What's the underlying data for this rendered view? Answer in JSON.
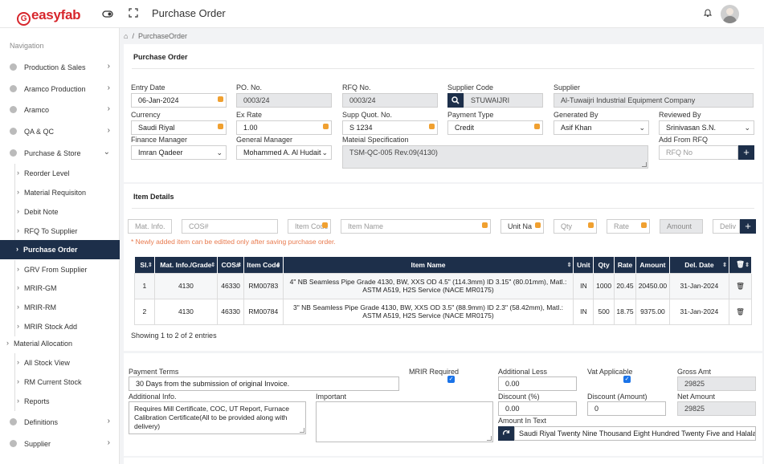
{
  "header": {
    "logo": "easyfab",
    "logo_mark": "G",
    "page_title": "Purchase Order"
  },
  "breadcrumb": {
    "current": "PurchaseOrder"
  },
  "sidebar": {
    "title": "Navigation",
    "items": [
      {
        "label": "Production & Sales"
      },
      {
        "label": "Aramco Production"
      },
      {
        "label": "Aramco"
      },
      {
        "label": "QA & QC"
      },
      {
        "label": "Purchase & Store"
      }
    ],
    "sub_items": [
      {
        "label": "Reorder Level"
      },
      {
        "label": "Material Requisiton"
      },
      {
        "label": "Debit Note"
      },
      {
        "label": "RFQ To Supplier"
      },
      {
        "label": "Purchase Order"
      },
      {
        "label": "GRV From Supplier"
      },
      {
        "label": "MRIR-GM"
      },
      {
        "label": "MRIR-RM"
      },
      {
        "label": "MRIR Stock Add"
      },
      {
        "label": "Material Allocation"
      },
      {
        "label": "All Stock View"
      },
      {
        "label": "RM Current Stock"
      },
      {
        "label": "Reports"
      }
    ],
    "bottom_items": [
      {
        "label": "Definitions"
      },
      {
        "label": "Supplier"
      }
    ]
  },
  "po": {
    "card_title": "Purchase Order",
    "entry_date": {
      "label": "Entry Date",
      "value": "06-Jan-2024"
    },
    "po_no": {
      "label": "PO. No.",
      "value": "0003/24"
    },
    "rfq_no": {
      "label": "RFQ No.",
      "value": "0003/24"
    },
    "supplier_code": {
      "label": "Supplier Code",
      "value": "STUWAIJRI"
    },
    "supplier": {
      "label": "Supplier",
      "value": "Al-Tuwaijri Industrial Equipment Company"
    },
    "currency": {
      "label": "Currency",
      "value": "Saudi Riyal"
    },
    "ex_rate": {
      "label": "Ex Rate",
      "value": "1.00"
    },
    "supp_quot": {
      "label": "Supp Quot. No.",
      "value": "S 1234"
    },
    "payment_type": {
      "label": "Payment Type",
      "value": "Credit"
    },
    "generated_by": {
      "label": "Generated By",
      "value": "Asif Khan"
    },
    "reviewed_by": {
      "label": "Reviewed By",
      "value": "Srinivasan S.N."
    },
    "finance_manager": {
      "label": "Finance Manager",
      "value": "Imran Qadeer"
    },
    "general_manager": {
      "label": "General Manager",
      "value": "Mohammed A. Al Hudaithi"
    },
    "material_spec": {
      "label": "Mateial Specification",
      "value": "TSM-QC-005 Rev.09(4130)"
    },
    "add_from_rfq": {
      "label": "Add From RFQ",
      "placeholder": "RFQ No"
    }
  },
  "item_details": {
    "card_title": "Item Details",
    "inputs": {
      "mat_info": "Mat. Info.",
      "cos": "COS#",
      "item_code": "Item Code",
      "item_name": "Item Name",
      "unit": "Unit Na",
      "qty": "Qty",
      "rate": "Rate",
      "amount": "Amount",
      "deliv": "Deliv"
    },
    "note": "* Newly added item can be editted only after saving purchase order.",
    "columns": [
      "Sl.",
      "Mat. Info./Grade",
      "COS#",
      "Item Code",
      "Item Name",
      "Unit",
      "Qty",
      "Rate",
      "Amount",
      "Del. Date",
      ""
    ],
    "rows": [
      {
        "sl": "1",
        "mat": "4130",
        "cos": "46330",
        "code": "RM00783",
        "name": "4\" NB Seamless Pipe Grade 4130, BW, XXS OD 4.5\" (114.3mm) ID 3.15\" (80.01mm), Matl.: ASTM A519, H2S Service (NACE MR0175)",
        "unit": "IN",
        "qty": "1000",
        "rate": "20.45",
        "amount": "20450.00",
        "del": "31-Jan-2024"
      },
      {
        "sl": "2",
        "mat": "4130",
        "cos": "46330",
        "code": "RM00784",
        "name": "3\" NB Seamless Pipe Grade 4130, BW, XXS OD 3.5\" (88.9mm) ID 2.3\" (58.42mm), Matl.: ASTM A519, H2S Service (NACE MR0175)",
        "unit": "IN",
        "qty": "500",
        "rate": "18.75",
        "amount": "9375.00",
        "del": "31-Jan-2024"
      }
    ],
    "showing": "Showing 1 to 2 of 2 entries"
  },
  "terms": {
    "payment_terms": {
      "label": "Payment Terms",
      "value": "30 Days from the submission of original Invoice."
    },
    "mrir_required": {
      "label": "MRIR Required"
    },
    "additional_less": {
      "label": "Additional Less",
      "value": "0.00"
    },
    "vat_applicable": {
      "label": "Vat Applicable"
    },
    "gross_amt": {
      "label": "Gross Amt",
      "value": "29825"
    },
    "additional_info": {
      "label": "Additional Info.",
      "value": "Requires Mill Certificate, COC, UT Report, Furnace Calibration Certificate(All to be provided along with delivery)"
    },
    "important": {
      "label": "Important",
      "value": ""
    },
    "discount_pct": {
      "label": "Discount (%)",
      "value": "0.00"
    },
    "discount_amt": {
      "label": "Discount (Amount)",
      "value": "0"
    },
    "net_amount": {
      "label": "Net Amount",
      "value": "29825"
    },
    "amount_in_text": {
      "label": "Amount In Text",
      "value": "Saudi Riyal Twenty Nine Thousand Eight Hundred Twenty Five and Halalas"
    }
  }
}
